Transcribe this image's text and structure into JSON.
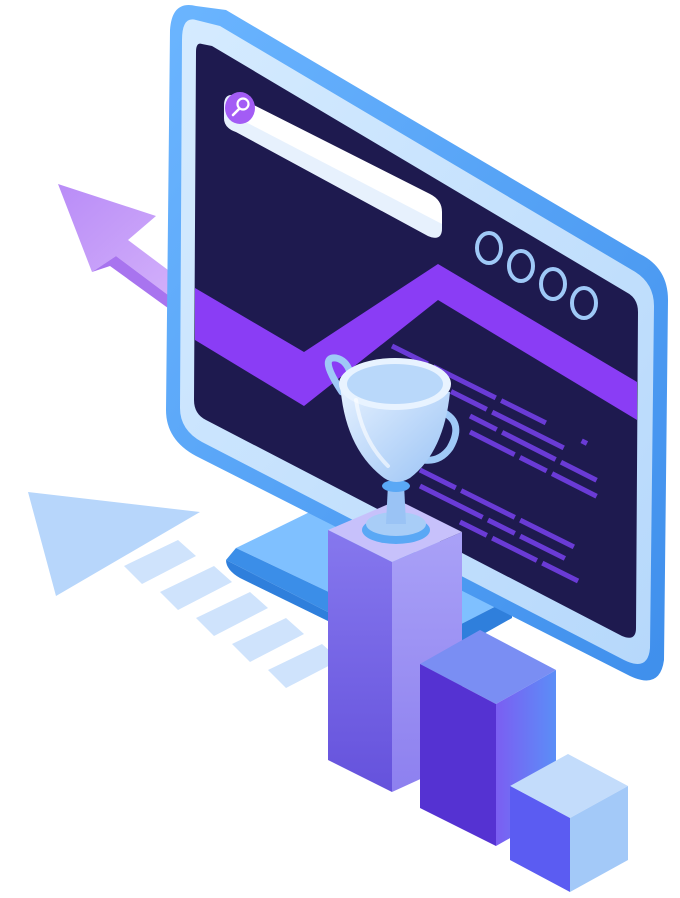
{
  "illustration": {
    "subject": "",
    "colors": {
      "monitor_frame": "#5aa8f5",
      "monitor_bezel": "#bfe0ff",
      "screen": "#1e1a4f",
      "trend_line": "#8a3df5",
      "search_bar": "#ffffff",
      "search_button": "#a35cf5",
      "dot_outline": "#9fc9f7",
      "text_lines": "#6a3bd6",
      "arrow_purple": "#c49af7",
      "arrow_blue": "#b7d6fb",
      "stand": "#4f9cf2",
      "trophy": "#a8cdf7",
      "podium_tall": "#7a6ae6",
      "podium_mid": "#5a3ed6",
      "podium_small": "#6f93f5"
    },
    "icons": [
      "search-icon",
      "trophy-icon",
      "arrow-up-icon"
    ],
    "screen_dots_count": 4,
    "text_line_rows": 5,
    "stripes_count": 5,
    "podium_count": 3
  }
}
